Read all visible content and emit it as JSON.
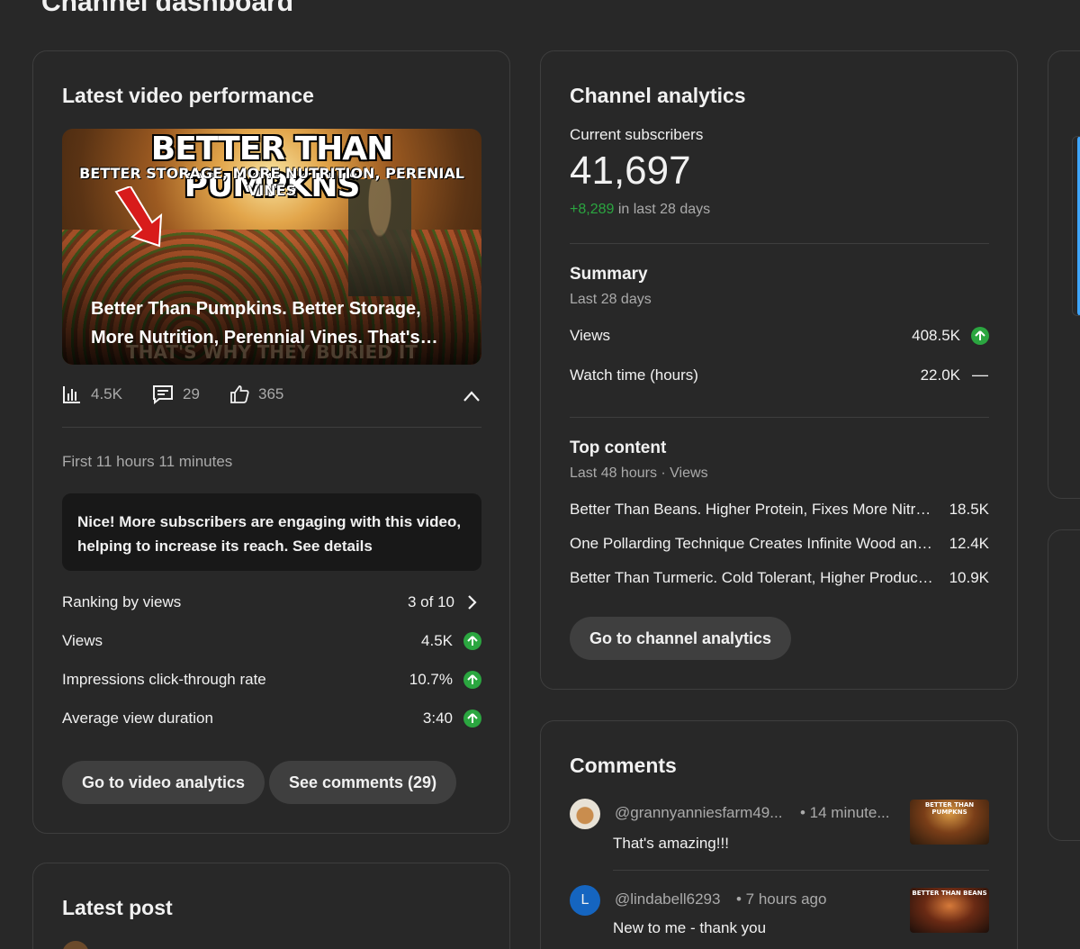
{
  "page_title": "Channel dashboard",
  "latest_video": {
    "card_title": "Latest video performance",
    "thumb_big": "BETTER THAN PUMPKNS",
    "thumb_small": "BETTER STORAGE, MORE NUTRITION, PERENIAL VINES",
    "thumb_bottom": "THAT'S WHY THEY BURIED IT",
    "title": "Better Than Pumpkins. Better Storage, More Nutrition, Perennial Vines. That's Why The...",
    "views": "4.5K",
    "comments": "29",
    "likes": "365",
    "period": "First 11 hours 11 minutes",
    "notice": "Nice! More subscribers are engaging with this video, helping to increase its reach. See details",
    "metrics": [
      {
        "label": "Ranking by views",
        "value": "3 of 10"
      },
      {
        "label": "Views",
        "value": "4.5K"
      },
      {
        "label": "Impressions click-through rate",
        "value": "10.7%"
      },
      {
        "label": "Average view duration",
        "value": "3:40"
      }
    ],
    "btn_analytics": "Go to video analytics",
    "btn_comments": "See comments (29)"
  },
  "latest_post": {
    "card_title": "Latest post"
  },
  "channel_analytics": {
    "card_title": "Channel analytics",
    "subs_label": "Current subscribers",
    "subs_value": "41,697",
    "subs_delta": "+8,289",
    "subs_delta_suffix": " in last 28 days",
    "summary_title": "Summary",
    "summary_period": "Last 28 days",
    "summary_rows": [
      {
        "label": "Views",
        "value": "408.5K"
      },
      {
        "label": "Watch time (hours)",
        "value": "22.0K"
      }
    ],
    "top_title": "Top content",
    "top_period": "Last 48 hours · Views",
    "top_rows": [
      {
        "label": "Better Than Beans. Higher Protein, Fixes More Nitrogen, Perennial",
        "value": "18.5K"
      },
      {
        "label": "One Pollarding Technique Creates Infinite Wood and More",
        "value": "12.4K"
      },
      {
        "label": "Better Than Turmeric. Cold Tolerant, Higher Production",
        "value": "10.9K"
      }
    ],
    "btn": "Go to channel analytics"
  },
  "comments": {
    "card_title": "Comments",
    "items": [
      {
        "author": "@grannyanniesfarm49...",
        "time": "• 14 minute...",
        "text": "That's amazing!!!",
        "thumb": "BETTER THAN PUMPKNS"
      },
      {
        "author": "@lindabell6293",
        "time": "• 7 hours ago",
        "text": "New to me - thank you",
        "avatar_letter": "L",
        "thumb": "BETTER THAN BEANS"
      }
    ]
  },
  "colors": {
    "background": "#282828",
    "card_border": "#3e3e3e",
    "positive": "#2ba640",
    "notice_bg": "#181818",
    "pill_bg": "#3f3f3f"
  }
}
